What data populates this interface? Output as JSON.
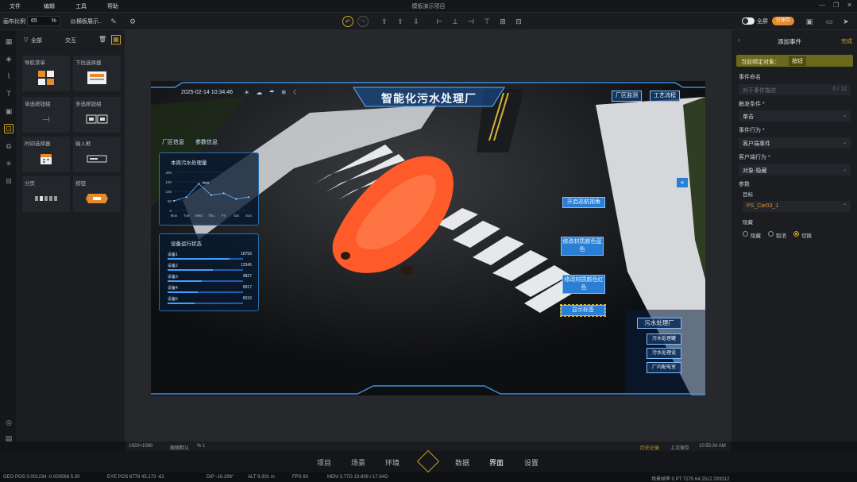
{
  "menu": {
    "items": [
      "文件",
      "编辑",
      "工具",
      "帮助"
    ],
    "title": "模板演示项目"
  },
  "toolbar": {
    "scale_label": "画布比例",
    "scale_value": "65",
    "scale_unit": "%",
    "display_mode": "横板展示..",
    "toggle_label": "全屏",
    "badge": "已保存"
  },
  "components": {
    "tabs": {
      "all": "全部",
      "interact": "交互"
    },
    "tiles": [
      {
        "label": "导航菜单",
        "icon": "grid-icon"
      },
      {
        "label": "下拉选择器",
        "icon": "dropdown-icon"
      },
      {
        "label": "单选按钮组",
        "icon": "radio-group-icon",
        "extra": "—|"
      },
      {
        "label": "多选按钮组",
        "icon": "checkbox-group-icon"
      },
      {
        "label": "时间选择器",
        "icon": "calendar-icon"
      },
      {
        "label": "输入框",
        "icon": "input-icon"
      },
      {
        "label": "分页",
        "icon": "pagination-icon"
      },
      {
        "label": "按钮",
        "icon": "button-icon"
      }
    ]
  },
  "scene": {
    "datetime": "2025-02-14 10:34:46",
    "title": "智能化污水处理厂",
    "top_right_buttons": [
      "厂区监测",
      "工艺流程"
    ],
    "left_tabs": [
      "厂区信息",
      "参数信息"
    ],
    "panel1": {
      "title": "本周污水处理量",
      "point_label": "data",
      "y_ticks": [
        "200",
        "150",
        "100",
        "50",
        "0"
      ],
      "x_ticks": [
        "Mon",
        "Tue",
        "Wed",
        "Thu",
        "Fri",
        "Sat",
        "Sun"
      ]
    },
    "panel2": {
      "title": "设备运行状态",
      "rows": [
        {
          "name": "设备1",
          "value": "18756",
          "pct": 0.82
        },
        {
          "name": "设备2",
          "value": "12345",
          "pct": 0.6
        },
        {
          "name": "设备3",
          "value": "9827",
          "pct": 0.45
        },
        {
          "name": "设备4",
          "value": "8917",
          "pct": 0.4
        },
        {
          "name": "设备5",
          "value": "8316",
          "pct": 0.36
        }
      ]
    },
    "scene_buttons": [
      "开启巡航视角",
      "修改材质颜色蓝色",
      "修改材质颜色红色",
      "显示标签"
    ],
    "plant_title": "污水处理厂",
    "plant_items": [
      "污水处理罐",
      "污水处理设",
      "厂内配电室"
    ]
  },
  "rpanel": {
    "header": "添加事件",
    "done": "完成",
    "bind_label": "当前绑定对象：",
    "bind_value": "按钮",
    "event_name_label": "事件命名",
    "event_name_placeholder": "对于事件描述",
    "event_name_count": "0 / 12",
    "trigger_label": "触发条件 *",
    "trigger_value": "单击",
    "action_label": "事件行为 *",
    "action_value": "客户端事件",
    "client_label": "客户端行为 *",
    "client_value": "对象-隐藏",
    "params_label": "参数",
    "target_label": "目标",
    "target_value": "PS_Car03_1",
    "display_label": "隐藏",
    "radio_options": [
      "隐藏",
      "取消",
      "切换"
    ],
    "radio_selected": 2
  },
  "statusbar": {
    "resolution": "1920×1080",
    "fit": "跟随默认",
    "zoom": "% 1",
    "history": "历史记录",
    "last_save": "上次保存",
    "time": "10:55:34 AM"
  },
  "bottomnav": {
    "items": [
      "项目",
      "场景",
      "环境",
      "数据",
      "界面",
      "设置"
    ],
    "active": "界面"
  },
  "footer": {
    "geo": "GEO POS  0.001234 -0.000568 5.30",
    "eye": "EYE POS  6778 45.173 -62",
    "dip": "DIP  -16.296°",
    "alt": "ALT  9.301 m",
    "fps": "FPS  60",
    "mem": "MEM  3.77G 13.806 / 17.84G",
    "right": "场景帧率  0  PT  7275  64.2512 293312"
  },
  "colors": {
    "accent": "#c9a227",
    "orange": "#e68a2e",
    "blue": "#2a7fd4",
    "bg": "#111316"
  }
}
